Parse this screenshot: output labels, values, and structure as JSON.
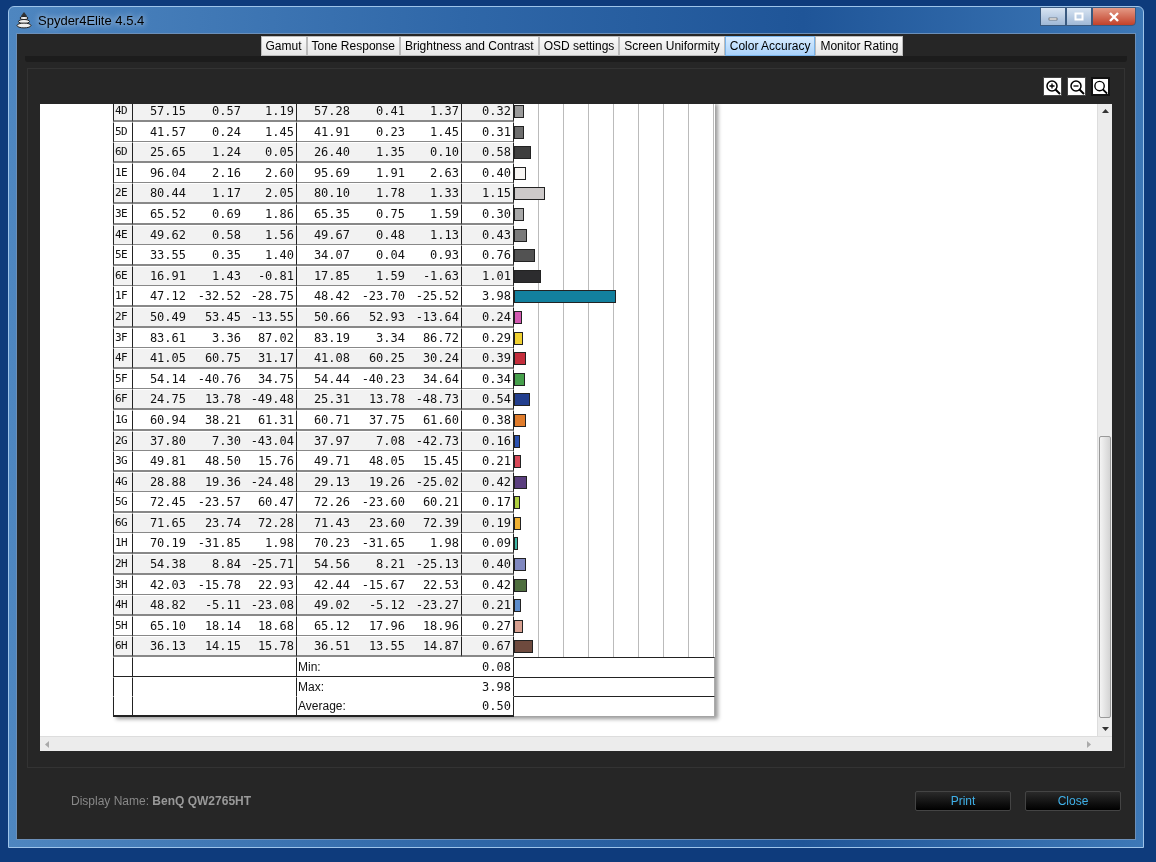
{
  "window": {
    "title": "Spyder4Elite 4.5.4"
  },
  "tabs": [
    {
      "label": "Gamut",
      "selected": false
    },
    {
      "label": "Tone Response",
      "selected": false
    },
    {
      "label": "Brightness and Contrast",
      "selected": false
    },
    {
      "label": "OSD settings",
      "selected": false
    },
    {
      "label": "Screen Uniformity",
      "selected": false
    },
    {
      "label": "Color Accuracy",
      "selected": true
    },
    {
      "label": "Monitor Rating",
      "selected": false
    }
  ],
  "table": {
    "rows": [
      {
        "patch": "4D",
        "values": [
          "57.15",
          "0.57",
          "1.19",
          "57.28",
          "0.41",
          "1.37"
        ],
        "delta_e": "0.32",
        "level": 0.04,
        "color": "#9a9a9a"
      },
      {
        "patch": "5D",
        "values": [
          "41.57",
          "0.24",
          "1.45",
          "41.91",
          "0.23",
          "1.45"
        ],
        "delta_e": "0.31",
        "level": 0.039,
        "color": "#6e6e6e"
      },
      {
        "patch": "6D",
        "values": [
          "25.65",
          "1.24",
          "0.05",
          "26.40",
          "1.35",
          "0.10"
        ],
        "delta_e": "0.58",
        "level": 0.0725,
        "color": "#3e3e3e"
      },
      {
        "patch": "1E",
        "values": [
          "96.04",
          "2.16",
          "2.60",
          "95.69",
          "1.91",
          "2.63"
        ],
        "delta_e": "0.40",
        "level": 0.05,
        "color": "#f8f6f4"
      },
      {
        "patch": "2E",
        "values": [
          "80.44",
          "1.17",
          "2.05",
          "80.10",
          "1.78",
          "1.33"
        ],
        "delta_e": "1.15",
        "level": 0.144,
        "color": "#cdc9c9"
      },
      {
        "patch": "3E",
        "values": [
          "65.52",
          "0.69",
          "1.86",
          "65.35",
          "0.75",
          "1.59"
        ],
        "delta_e": "0.30",
        "level": 0.0375,
        "color": "#a9a9a9"
      },
      {
        "patch": "4E",
        "values": [
          "49.62",
          "0.58",
          "1.56",
          "49.67",
          "0.48",
          "1.13"
        ],
        "delta_e": "0.43",
        "level": 0.054,
        "color": "#7b7b7b"
      },
      {
        "patch": "5E",
        "values": [
          "33.55",
          "0.35",
          "1.40",
          "34.07",
          "0.04",
          "0.93"
        ],
        "delta_e": "0.76",
        "level": 0.095,
        "color": "#525252"
      },
      {
        "patch": "6E",
        "values": [
          "16.91",
          "1.43",
          "-0.81",
          "17.85",
          "1.59",
          "-1.63"
        ],
        "delta_e": "1.01",
        "level": 0.126,
        "color": "#2c2c2e"
      },
      {
        "patch": "1F",
        "values": [
          "47.12",
          "-32.52",
          "-28.75",
          "48.42",
          "-23.70",
          "-25.52"
        ],
        "delta_e": "3.98",
        "level": 0.4975,
        "color": "#12809e"
      },
      {
        "patch": "2F",
        "values": [
          "50.49",
          "53.45",
          "-13.55",
          "50.66",
          "52.93",
          "-13.64"
        ],
        "delta_e": "0.24",
        "level": 0.03,
        "color": "#d258b0"
      },
      {
        "patch": "3F",
        "values": [
          "83.61",
          "3.36",
          "87.02",
          "83.19",
          "3.34",
          "86.72"
        ],
        "delta_e": "0.29",
        "level": 0.036,
        "color": "#f0d030"
      },
      {
        "patch": "4F",
        "values": [
          "41.05",
          "60.75",
          "31.17",
          "41.08",
          "60.25",
          "30.24"
        ],
        "delta_e": "0.39",
        "level": 0.049,
        "color": "#c42e3c"
      },
      {
        "patch": "5F",
        "values": [
          "54.14",
          "-40.76",
          "34.75",
          "54.44",
          "-40.23",
          "34.64"
        ],
        "delta_e": "0.34",
        "level": 0.0425,
        "color": "#46a04c"
      },
      {
        "patch": "6F",
        "values": [
          "24.75",
          "13.78",
          "-49.48",
          "25.31",
          "13.78",
          "-48.73"
        ],
        "delta_e": "0.54",
        "level": 0.0675,
        "color": "#223e8e"
      },
      {
        "patch": "1G",
        "values": [
          "60.94",
          "38.21",
          "61.31",
          "60.71",
          "37.75",
          "61.60"
        ],
        "delta_e": "0.38",
        "level": 0.0475,
        "color": "#e07c2c"
      },
      {
        "patch": "2G",
        "values": [
          "37.80",
          "7.30",
          "-43.04",
          "37.97",
          "7.08",
          "-42.73"
        ],
        "delta_e": "0.16",
        "level": 0.02,
        "color": "#2a50b0"
      },
      {
        "patch": "3G",
        "values": [
          "49.81",
          "48.50",
          "15.76",
          "49.71",
          "48.05",
          "15.45"
        ],
        "delta_e": "0.21",
        "level": 0.026,
        "color": "#d84858"
      },
      {
        "patch": "4G",
        "values": [
          "28.88",
          "19.36",
          "-24.48",
          "29.13",
          "19.26",
          "-25.02"
        ],
        "delta_e": "0.42",
        "level": 0.0525,
        "color": "#5a3e7e"
      },
      {
        "patch": "5G",
        "values": [
          "72.45",
          "-23.57",
          "60.47",
          "72.26",
          "-23.60",
          "60.21"
        ],
        "delta_e": "0.17",
        "level": 0.021,
        "color": "#b0d040"
      },
      {
        "patch": "6G",
        "values": [
          "71.65",
          "23.74",
          "72.28",
          "71.43",
          "23.60",
          "72.39"
        ],
        "delta_e": "0.19",
        "level": 0.024,
        "color": "#f0b030"
      },
      {
        "patch": "1H",
        "values": [
          "70.19",
          "-31.85",
          "1.98",
          "70.23",
          "-31.65",
          "1.98"
        ],
        "delta_e": "0.09",
        "level": 0.011,
        "color": "#40b8a8"
      },
      {
        "patch": "2H",
        "values": [
          "54.38",
          "8.84",
          "-25.71",
          "54.56",
          "8.21",
          "-25.13"
        ],
        "delta_e": "0.40",
        "level": 0.05,
        "color": "#8088c0"
      },
      {
        "patch": "3H",
        "values": [
          "42.03",
          "-15.78",
          "22.93",
          "42.44",
          "-15.67",
          "22.53"
        ],
        "delta_e": "0.42",
        "level": 0.0525,
        "color": "#4e6e3e"
      },
      {
        "patch": "4H",
        "values": [
          "48.82",
          "-5.11",
          "-23.08",
          "49.02",
          "-5.12",
          "-23.27"
        ],
        "delta_e": "0.21",
        "level": 0.026,
        "color": "#5c8ccc"
      },
      {
        "patch": "5H",
        "values": [
          "65.10",
          "18.14",
          "18.68",
          "65.12",
          "17.96",
          "18.96"
        ],
        "delta_e": "0.27",
        "level": 0.034,
        "color": "#d8a090"
      },
      {
        "patch": "6H",
        "values": [
          "36.13",
          "14.15",
          "15.78",
          "36.51",
          "13.55",
          "14.87"
        ],
        "delta_e": "0.67",
        "level": 0.084,
        "color": "#6e4a3e"
      }
    ],
    "summary": [
      {
        "label": "Min:",
        "value": "0.08"
      },
      {
        "label": "Max:",
        "value": "3.98"
      },
      {
        "label": "Average:",
        "value": "0.50"
      }
    ]
  },
  "display_name": {
    "label": "Display Name:",
    "value": "BenQ QW2765HT"
  },
  "buttons": [
    "Print",
    "Close"
  ]
}
